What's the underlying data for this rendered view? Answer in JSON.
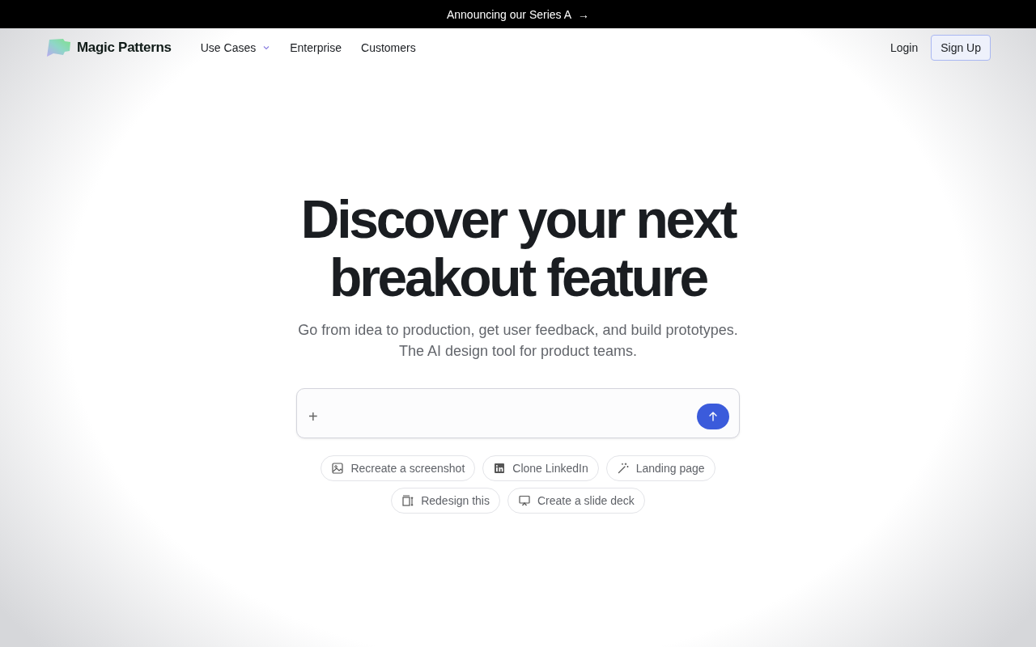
{
  "banner": {
    "text": "Announcing our Series A",
    "icon": "→"
  },
  "nav": {
    "brand": "Magic Patterns",
    "links": [
      {
        "label": "Use Cases",
        "dropdown": true
      },
      {
        "label": "Enterprise",
        "dropdown": false
      },
      {
        "label": "Customers",
        "dropdown": false
      }
    ],
    "login": "Login",
    "signup": "Sign Up"
  },
  "hero": {
    "title_lines": [
      "Discover your next",
      "breakout feature"
    ],
    "subtitle_lines": [
      "Go from idea to production, get user feedback, and build prototypes.",
      "The AI design tool for product teams."
    ]
  },
  "prompt": {
    "add_icon": "+"
  },
  "suggestions": [
    [
      {
        "kind": "image",
        "label": "Recreate a screenshot"
      },
      {
        "kind": "linkedin",
        "label": "Clone LinkedIn"
      },
      {
        "kind": "wand",
        "label": "Landing page"
      }
    ],
    [
      {
        "kind": "resize",
        "label": "Redesign this"
      },
      {
        "kind": "presentation",
        "label": "Create a slide deck"
      }
    ]
  ]
}
